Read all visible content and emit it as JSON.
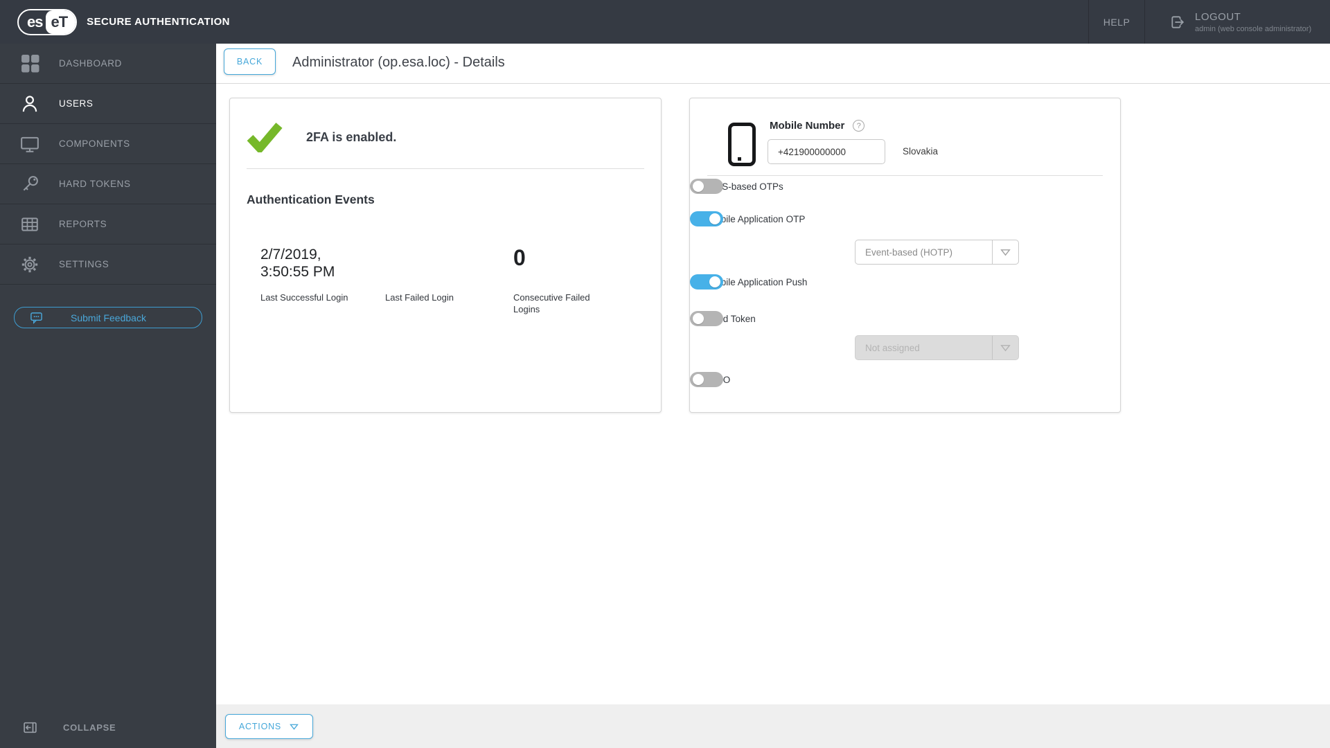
{
  "topbar": {
    "logo_left": "es",
    "logo_right": "eT",
    "registered": "®",
    "brand": "SECURE AUTHENTICATION",
    "help": "HELP",
    "logout": "LOGOUT",
    "logout_sub": "admin (web console administrator)"
  },
  "sidebar": {
    "items": [
      {
        "label": "DASHBOARD",
        "icon": "dashboard-icon",
        "active": false
      },
      {
        "label": "USERS",
        "icon": "users-icon",
        "active": true
      },
      {
        "label": "COMPONENTS",
        "icon": "components-icon",
        "active": false
      },
      {
        "label": "HARD TOKENS",
        "icon": "hard-tokens-icon",
        "active": false
      },
      {
        "label": "REPORTS",
        "icon": "reports-icon",
        "active": false
      },
      {
        "label": "SETTINGS",
        "icon": "settings-icon",
        "active": false
      }
    ],
    "feedback": "Submit Feedback",
    "collapse": "COLLAPSE"
  },
  "header": {
    "back": "BACK",
    "title": "Administrator (op.esa.loc) - Details"
  },
  "status_card": {
    "message": "2FA is enabled.",
    "section": "Authentication Events",
    "stats": [
      {
        "value": "2/7/2019, 3:50:55 PM",
        "label": "Last Successful Login"
      },
      {
        "value": "",
        "label": "Last Failed Login"
      },
      {
        "value": "0",
        "label": "Consecutive Failed Logins"
      }
    ]
  },
  "mobile_card": {
    "title": "Mobile Number",
    "help_glyph": "?",
    "number": "+421900000000",
    "country": "Slovakia",
    "rows": [
      {
        "label": "SMS-based OTPs",
        "state": "off"
      },
      {
        "label": "Mobile Application OTP",
        "state": "on",
        "select": "Event-based (HOTP)",
        "select_disabled": false
      },
      {
        "label": "Mobile Application Push",
        "state": "on"
      },
      {
        "label": "Hard Token",
        "state": "off",
        "select": "Not assigned",
        "select_disabled": true
      },
      {
        "label": "FIDO",
        "state": "off"
      }
    ]
  },
  "footer": {
    "actions": "ACTIONS"
  },
  "colors": {
    "topbar_bg": "#353a43",
    "sidebar_bg": "#383d44",
    "accent_blue": "#45a7d9",
    "toggle_on_blue": "#47b1e8",
    "toggle_off_gray": "#b4b4b4",
    "success_green": "#76b82a",
    "footer_bg": "#efefef"
  }
}
